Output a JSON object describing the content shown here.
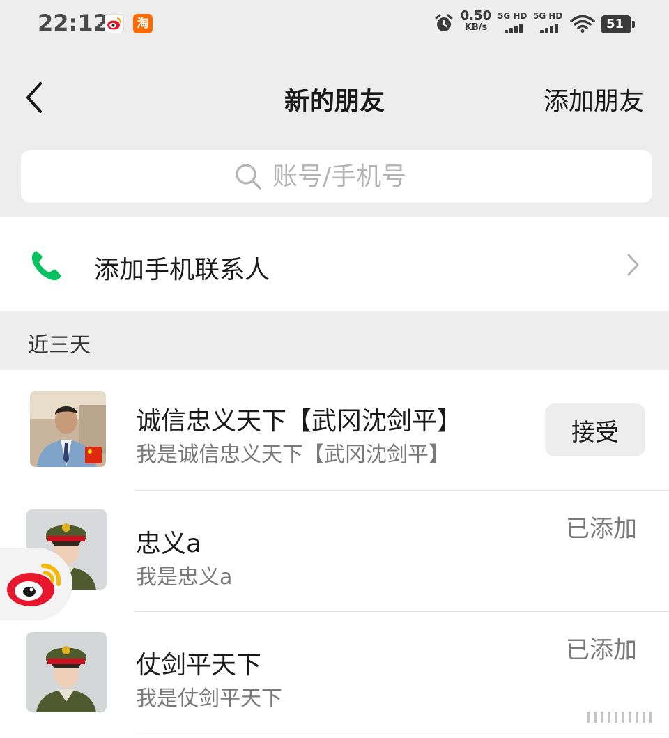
{
  "status_bar": {
    "time": "22:12",
    "taobao_badge": "淘",
    "speed_value": "0.50",
    "speed_unit": "KB/s",
    "signal1_label": "5G HD",
    "signal2_label": "5G HD",
    "battery": "51",
    "icons": [
      "weibo-icon",
      "taobao-icon",
      "alarm-icon",
      "signal-icon",
      "signal-icon",
      "wifi-icon",
      "battery-icon"
    ]
  },
  "nav": {
    "title": "新的朋友",
    "action": "添加朋友",
    "back_icon": "chevron-left-icon"
  },
  "search": {
    "placeholder": "账号/手机号"
  },
  "add_contact": {
    "label": "添加手机联系人",
    "icon": "phone-icon",
    "icon_color": "#07c160"
  },
  "section": {
    "header": "近三天"
  },
  "requests": [
    {
      "name": "诚信忠义天下【武冈沈剑平】",
      "message": "我是诚信忠义天下【武冈沈剑平】",
      "action": "接受"
    },
    {
      "name": "忠义a",
      "message": "我是忠义a",
      "status": "已添加"
    },
    {
      "name": "仗剑平天下",
      "message": "我是仗剑平天下",
      "status": "已添加"
    }
  ],
  "colors": {
    "background": "#ededed",
    "accent_green": "#07c160",
    "weibo_red": "#e6162d",
    "weibo_yellow": "#f5b800"
  }
}
